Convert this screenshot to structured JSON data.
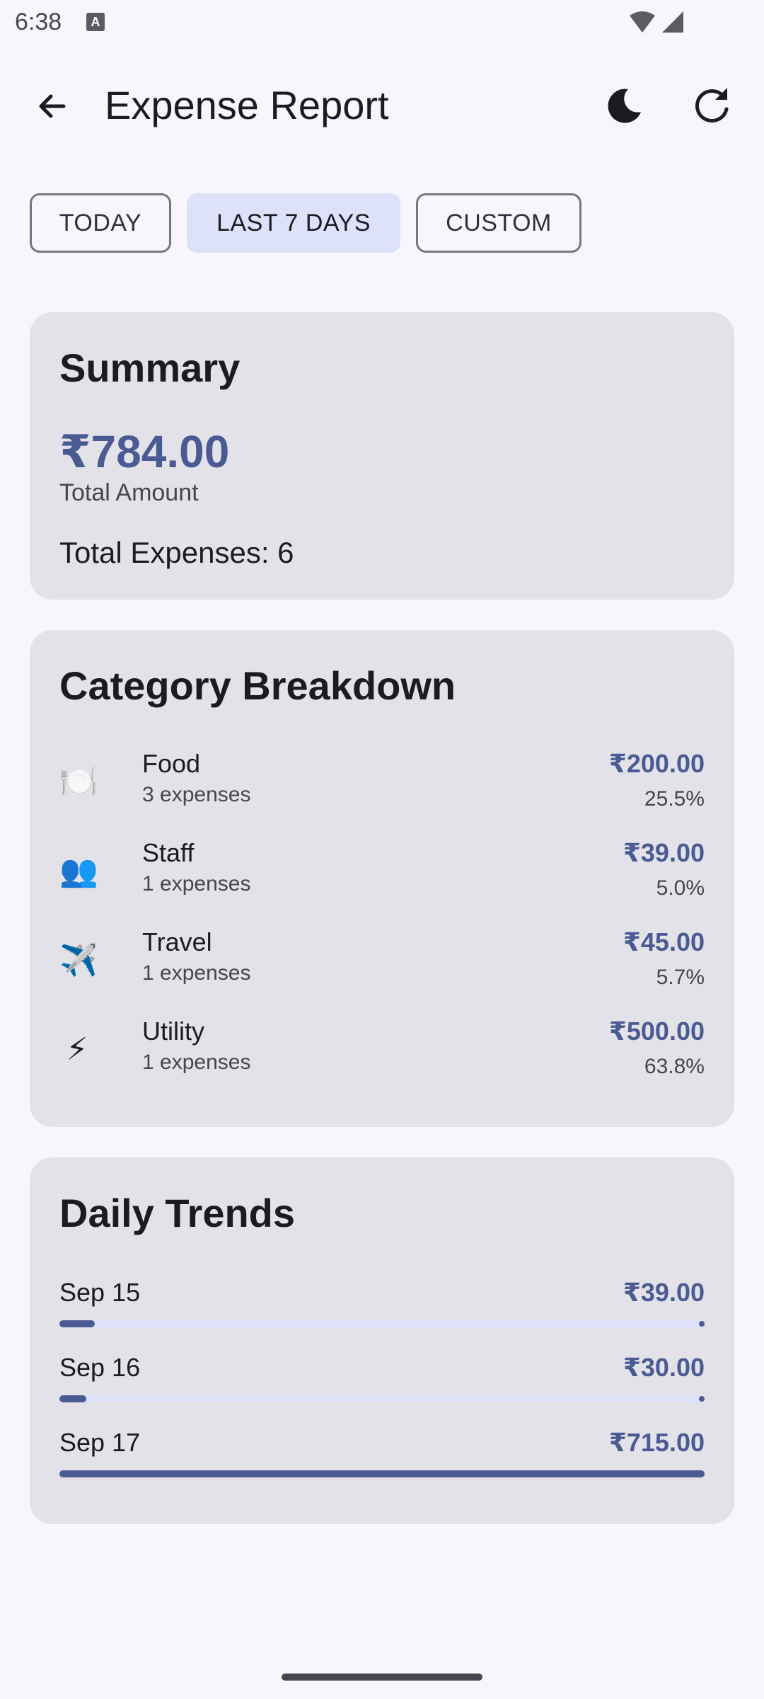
{
  "status_bar": {
    "time": "6:38",
    "notification_icon": "A"
  },
  "header": {
    "title": "Expense Report",
    "back_icon": "arrow-back",
    "theme_icon": "moon",
    "refresh_icon": "refresh"
  },
  "filters": [
    {
      "label": "TODAY",
      "selected": false
    },
    {
      "label": "LAST 7 DAYS",
      "selected": true
    },
    {
      "label": "CUSTOM",
      "selected": false
    }
  ],
  "summary": {
    "title": "Summary",
    "total_amount": "₹784.00",
    "total_amount_label": "Total Amount",
    "total_expenses": "Total Expenses: 6"
  },
  "category_breakdown": {
    "title": "Category Breakdown",
    "items": [
      {
        "icon": "🍽️",
        "icon_name": "plate-cutlery-icon",
        "name": "Food",
        "count": "3 expenses",
        "amount": "₹200.00",
        "percent": "25.5%"
      },
      {
        "icon": "👥",
        "icon_name": "people-icon",
        "name": "Staff",
        "count": "1 expenses",
        "amount": "₹39.00",
        "percent": "5.0%"
      },
      {
        "icon": "✈️",
        "icon_name": "airplane-icon",
        "name": "Travel",
        "count": "1 expenses",
        "amount": "₹45.00",
        "percent": "5.7%"
      },
      {
        "icon": "⚡",
        "icon_name": "lightning-icon",
        "name": "Utility",
        "count": "1 expenses",
        "amount": "₹500.00",
        "percent": "63.8%"
      }
    ]
  },
  "daily_trends": {
    "title": "Daily Trends",
    "items": [
      {
        "date": "Sep 15",
        "amount": "₹39.00",
        "progress": 0.055
      },
      {
        "date": "Sep 16",
        "amount": "₹30.00",
        "progress": 0.042
      },
      {
        "date": "Sep 17",
        "amount": "₹715.00",
        "progress": 1.0
      }
    ]
  },
  "colors": {
    "accent": "#4a5b94",
    "selected_chip": "#dde1f9",
    "card": "#e3e2e9",
    "background": "#f7f6fc"
  }
}
